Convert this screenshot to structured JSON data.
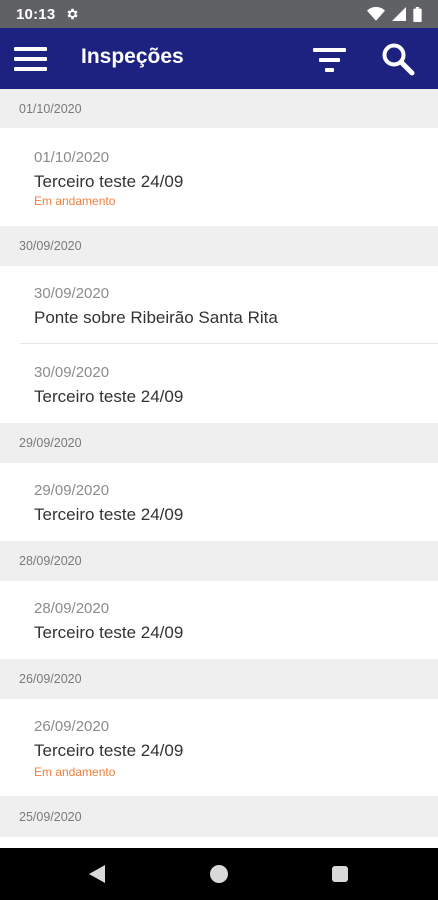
{
  "status_bar": {
    "time": "10:13",
    "icons": [
      "settings-gear-icon",
      "wifi-icon",
      "signal-icon",
      "battery-icon"
    ]
  },
  "app_bar": {
    "title": "Inspeções",
    "color": "#1d2280",
    "icons": [
      "menu-icon",
      "filter-icon",
      "search-icon"
    ]
  },
  "list": {
    "sections": [
      {
        "header": "01/10/2020",
        "items": [
          {
            "date": "01/10/2020",
            "title": "Terceiro teste 24/09",
            "status": "Em andamento"
          }
        ]
      },
      {
        "header": "30/09/2020",
        "items": [
          {
            "date": "30/09/2020",
            "title": "Ponte sobre Ribeirão Santa Rita"
          },
          {
            "date": "30/09/2020",
            "title": "Terceiro teste 24/09"
          }
        ]
      },
      {
        "header": "29/09/2020",
        "items": [
          {
            "date": "29/09/2020",
            "title": "Terceiro teste 24/09"
          }
        ]
      },
      {
        "header": "28/09/2020",
        "items": [
          {
            "date": "28/09/2020",
            "title": "Terceiro teste 24/09"
          }
        ]
      },
      {
        "header": "26/09/2020",
        "items": [
          {
            "date": "26/09/2020",
            "title": "Terceiro teste 24/09",
            "status": "Em andamento"
          }
        ]
      },
      {
        "header": "25/09/2020",
        "items": []
      }
    ],
    "status_color": "#f0803c"
  },
  "nav_bar": {
    "icons": [
      "back-icon",
      "home-icon",
      "recents-icon"
    ]
  }
}
